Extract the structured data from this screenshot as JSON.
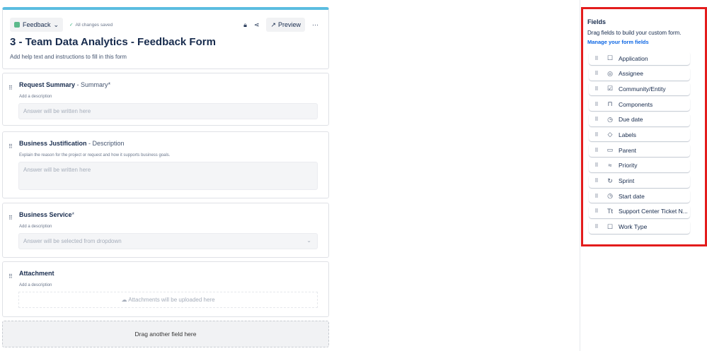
{
  "header": {
    "type_label": "Feedback",
    "saved": "All changes saved",
    "preview": "Preview",
    "more": "···",
    "title": "3 - Team Data Analytics - Feedback Form",
    "help": "Add help text and instructions to fill in this form"
  },
  "fields": [
    {
      "label": "Request Summary",
      "mapped": "- Summary",
      "required": true,
      "desc": "Add a description",
      "answer": "Answer will be written here"
    },
    {
      "label": "Business Justification",
      "mapped": "- Description",
      "required": false,
      "desc": "Explain the reason for the project or request and how it supports business goals.",
      "answer": "Answer will be written here"
    },
    {
      "label": "Business Service",
      "mapped": "",
      "required": true,
      "desc": "Add a description",
      "answer": "Answer will be selected from dropdown"
    },
    {
      "label": "Attachment",
      "mapped": "",
      "required": false,
      "desc": "Add a description",
      "answer": "Attachments will be uploaded here"
    }
  ],
  "dropzone": "Drag another field here",
  "panel": {
    "title": "Fields",
    "desc": "Drag fields to build your custom form.",
    "link": "Manage your form fields",
    "items": [
      {
        "label": "Application",
        "icon": "☐"
      },
      {
        "label": "Assignee",
        "icon": "◎"
      },
      {
        "label": "Community/Entity",
        "icon": "☑"
      },
      {
        "label": "Components",
        "icon": "⊓"
      },
      {
        "label": "Due date",
        "icon": "◷"
      },
      {
        "label": "Labels",
        "icon": "◇"
      },
      {
        "label": "Parent",
        "icon": "▭"
      },
      {
        "label": "Priority",
        "icon": "≈"
      },
      {
        "label": "Sprint",
        "icon": "↻"
      },
      {
        "label": "Start date",
        "icon": "◷"
      },
      {
        "label": "Support Center Ticket N...",
        "icon": "Tt"
      },
      {
        "label": "Work Type",
        "icon": "☐"
      }
    ]
  },
  "colors": {
    "accent": "#5bbde0",
    "highlight": "#e31c1c",
    "link": "#0c66e4"
  }
}
